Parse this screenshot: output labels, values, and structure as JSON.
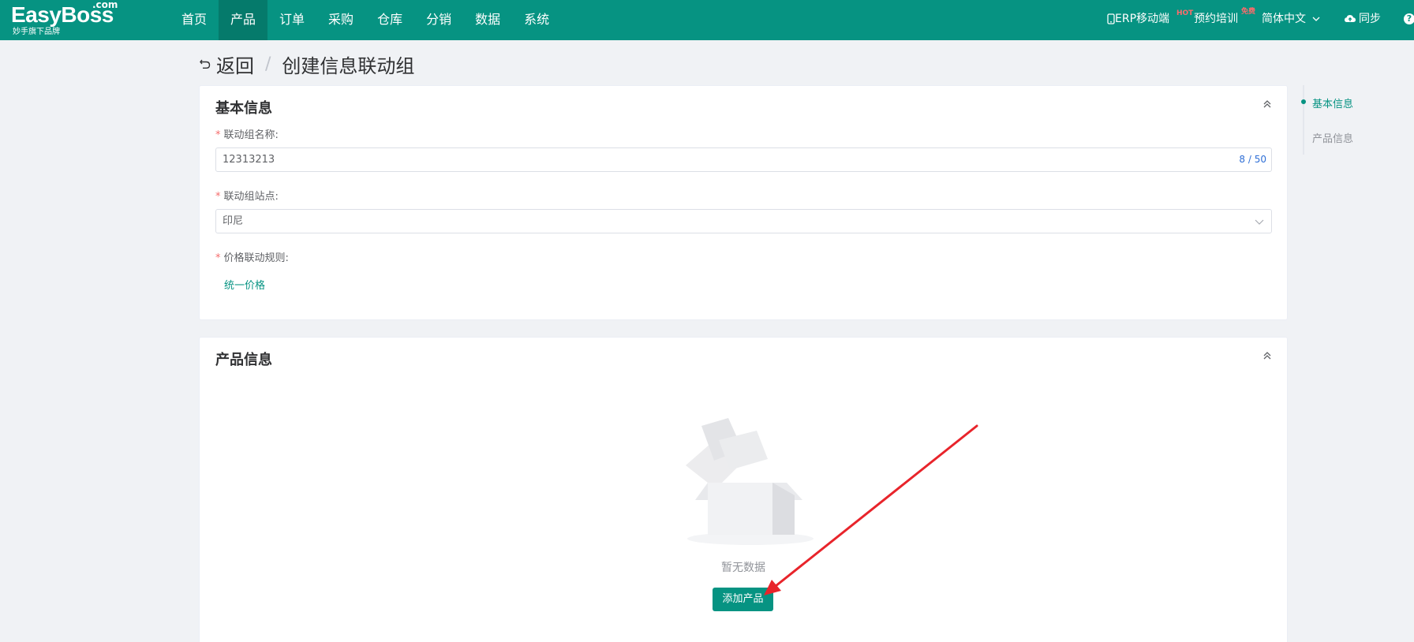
{
  "brand": {
    "name": "EasyBoss",
    "suffix": ".com",
    "tagline": "妙手旗下品牌"
  },
  "nav": {
    "items": [
      "首页",
      "产品",
      "订单",
      "采购",
      "仓库",
      "分销",
      "数据",
      "系统"
    ],
    "active_index": 1
  },
  "header_right": {
    "erp_mobile": "ERP移动端",
    "erp_badge": "HOT",
    "training": "预约培训",
    "training_badge": "免费",
    "language": "简体中文",
    "sync": "同步",
    "help": "?"
  },
  "page": {
    "back": "返回",
    "separator": "/",
    "title": "创建信息联动组"
  },
  "basic_info": {
    "title": "基本信息",
    "name_field": {
      "label": "联动组名称:",
      "value": "12313213",
      "count": "8 / 50"
    },
    "site_field": {
      "label": "联动组站点:",
      "value": "印尼"
    },
    "rule_field": {
      "label": "价格联动规则:",
      "value": "统一价格"
    }
  },
  "product_info": {
    "title": "产品信息",
    "empty_text": "暂无数据",
    "add_button": "添加产品"
  },
  "anchor": {
    "items": [
      "基本信息",
      "产品信息"
    ],
    "active_index": 0
  },
  "colors": {
    "primary": "#069382",
    "nav_active": "#057a6b",
    "required": "#f56c6c",
    "arrow": "#e8242b"
  }
}
